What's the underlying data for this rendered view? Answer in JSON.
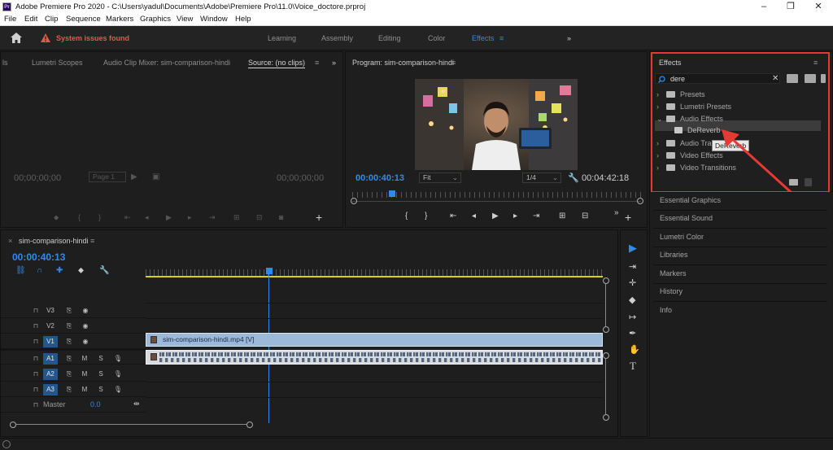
{
  "titlebar": {
    "app_logo": "Pr",
    "title": "Adobe Premiere Pro 2020 - C:\\Users\\yadul\\Documents\\Adobe\\Premiere Pro\\11.0\\Voice_doctore.prproj",
    "minimize": "–",
    "maximize": "❐",
    "close": "✕"
  },
  "menu": [
    "File",
    "Edit",
    "Clip",
    "Sequence",
    "Markers",
    "Graphics",
    "View",
    "Window",
    "Help"
  ],
  "workspace": {
    "warning": "System issues found",
    "tabs": [
      "Learning",
      "Assembly",
      "Editing",
      "Color",
      "Effects"
    ],
    "active_tab": "Effects",
    "menu_icon": "≡",
    "overflow": "»"
  },
  "source_panel": {
    "tabs": [
      "ls",
      "Lumetri Scopes",
      "Audio Clip Mixer: sim-comparison-hindi",
      "Source: (no clips)"
    ],
    "menu_icon": "≡",
    "overflow": "»",
    "timecode_left": "00;00;00;00",
    "page": "Page 1",
    "timecode_right": "00;00;00;00",
    "add": "+"
  },
  "program_panel": {
    "title": "Program: sim-comparison-hindi",
    "menu_icon": "≡",
    "timecode": "00:00:40:13",
    "fit": "Fit",
    "resolution": "1/4",
    "duration": "00:04:42:18",
    "add": "+",
    "overflow": "»"
  },
  "effects_panel": {
    "title": "Effects",
    "menu_icon": "≡",
    "search_value": "dere",
    "clear": "✕",
    "items": [
      {
        "label": "Presets",
        "type": "folder",
        "expanded": false
      },
      {
        "label": "Lumetri Presets",
        "type": "folder",
        "expanded": false
      },
      {
        "label": "Audio Effects",
        "type": "folder",
        "expanded": true
      },
      {
        "label": "DeReverb",
        "type": "effect",
        "selected": true
      },
      {
        "label": "Audio Tran",
        "type": "folder",
        "expanded": false
      },
      {
        "label": "Video Effects",
        "type": "folder",
        "expanded": false
      },
      {
        "label": "Video Transitions",
        "type": "folder",
        "expanded": false
      }
    ],
    "tooltip": "DeReverb",
    "highlight_color": "#e53935"
  },
  "side_panels": [
    "Essential Graphics",
    "Essential Sound",
    "Lumetri Color",
    "Libraries",
    "Markers",
    "History",
    "Info"
  ],
  "timeline": {
    "tab_close": "×",
    "sequence": "sim-comparison-hindi",
    "menu_icon": "≡",
    "timecode": "00:00:40:13",
    "video_tracks": [
      {
        "name": "V3",
        "active": false
      },
      {
        "name": "V2",
        "active": false
      },
      {
        "name": "V1",
        "active": true,
        "target": "V1"
      }
    ],
    "audio_tracks": [
      {
        "name": "A1",
        "target": "A1"
      },
      {
        "name": "A2",
        "target": "A2"
      },
      {
        "name": "A3",
        "target": "A3"
      }
    ],
    "toggle_glyph": "⎘",
    "eye_glyph": "◉",
    "mute_label": "M",
    "solo_label": "S",
    "master_label": "Master",
    "master_value": "0.0",
    "video_clip": "sim-comparison-hindi.mp4 [V]",
    "lock_glyph": "🔒"
  },
  "tools": [
    "▶",
    "⇥",
    "✛",
    "◆",
    "↦",
    "✒",
    "✋",
    "T"
  ],
  "colors": {
    "accent_blue": "#2d8ceb",
    "warning_red": "#e05a4f",
    "clip_blue": "#9cb9d9",
    "work_area_yellow": "#d9d200"
  }
}
